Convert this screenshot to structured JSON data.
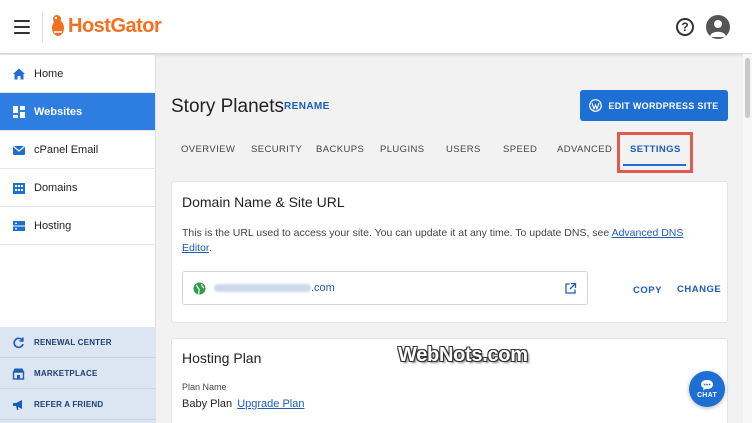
{
  "header": {
    "logo_text": "HostGator",
    "help_glyph": "?",
    "icons": [
      "menu-icon",
      "gator-logo-icon",
      "help-icon",
      "avatar-icon"
    ]
  },
  "sidebar": {
    "items": [
      {
        "label": "Home",
        "icon": "home-icon",
        "active": false
      },
      {
        "label": "Websites",
        "icon": "grid-icon",
        "active": true
      },
      {
        "label": "cPanel Email",
        "icon": "mail-icon",
        "active": false
      },
      {
        "label": "Domains",
        "icon": "building-icon",
        "active": false
      },
      {
        "label": "Hosting",
        "icon": "server-icon",
        "active": false
      }
    ],
    "bottom_items": [
      {
        "label": "RENEWAL CENTER",
        "icon": "refresh-icon"
      },
      {
        "label": "MARKETPLACE",
        "icon": "store-icon"
      },
      {
        "label": "REFER A FRIEND",
        "icon": "megaphone-icon"
      }
    ]
  },
  "site": {
    "title": "Story Planets",
    "rename_label": "RENAME",
    "edit_button_label": "EDIT WORDPRESS SITE"
  },
  "tabs": [
    {
      "label": "OVERVIEW",
      "active": false
    },
    {
      "label": "SECURITY",
      "active": false
    },
    {
      "label": "BACKUPS",
      "active": false
    },
    {
      "label": "PLUGINS",
      "active": false
    },
    {
      "label": "USERS",
      "active": false
    },
    {
      "label": "SPEED",
      "active": false
    },
    {
      "label": "ADVANCED",
      "active": false
    },
    {
      "label": "SETTINGS",
      "active": true
    }
  ],
  "domain_card": {
    "title": "Domain Name & Site URL",
    "description_prefix": "This is the URL used to access your site. You can update it at any time. To update DNS, see ",
    "description_link": "Advanced DNS Editor",
    "description_suffix": ".",
    "url_suffix": ".com",
    "copy_label": "COPY",
    "change_label": "CHANGE"
  },
  "hosting_card": {
    "title": "Hosting Plan",
    "field_label": "Plan Name",
    "plan_value": "Baby Plan",
    "upgrade_link": "Upgrade Plan"
  },
  "watermark": "WebNots.com",
  "chat_label": "CHAT",
  "colors": {
    "brand_orange": "#f37021",
    "accent_blue": "#1d6fd3",
    "active_nav": "#2e7de1",
    "link_blue": "#1d5cb8",
    "highlight_red": "#e05a4f"
  }
}
